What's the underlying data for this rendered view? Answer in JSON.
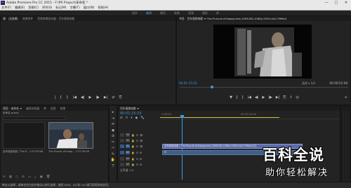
{
  "titlebar": {
    "app_badge": "Pr",
    "title": "Adobe Premiere Pro CC 2015 - F:\\PR Project\\未命名 *",
    "controls": [
      "—",
      "□",
      "✕"
    ]
  },
  "menubar": {
    "items": [
      "文件(F)",
      "编辑(E)",
      "剪辑(C)",
      "序列(S)",
      "标记(M)",
      "字幕(T)",
      "窗口(W)",
      "帮助(H)"
    ]
  },
  "workspaces": {
    "items": [
      "组件",
      "编辑",
      "颜色",
      "效果",
      "音频",
      "图形",
      "库"
    ],
    "active_index": 1
  },
  "source_panel": {
    "tabs": [
      "源：(无剪辑)",
      "效果控件",
      "音频剪辑混合器：百年孤独电影"
    ],
    "active_tab": 0,
    "transport": [
      "|",
      "{",
      "}",
      "|◀",
      "◀|",
      "▶",
      "|▶",
      "▶|",
      "⇄",
      "⎘"
    ]
  },
  "program_panel": {
    "title": "节目：百年孤独电影 ≡  The.Pursuit.of.Happyness.2006.BD-1080p.X264.AAC.99Mp4",
    "timecode_current": "00:01:15:23",
    "timecode_duration": "00:00:52:08",
    "fit_label": "适合",
    "quality": "1/2",
    "transport": [
      "▼",
      "{",
      "}",
      "|◀",
      "◀|",
      "▶",
      "|▶",
      "▶|",
      "⎘",
      "⇪",
      "◎"
    ],
    "add_button": "+"
  },
  "project_panel": {
    "tabs": [
      "项目：未命名 ≡",
      "媒体浏览器",
      "库",
      "信息",
      "效果"
    ],
    "active_tab": 0,
    "path": "未命名.prproj",
    "items_count": "1 项已选择，共 2 项",
    "items": [
      {
        "label": "百年孤独电影 | The.P...",
        "duration": "1:57:39:08"
      },
      {
        "label": "The.Pursuit.of.Happ...",
        "duration": "1:57:39:08"
      }
    ],
    "tools": [
      "≡",
      "▦",
      "○",
      "⊟",
      "▭",
      "⌕",
      "▣",
      "🗑"
    ]
  },
  "tool_icons": [
    "▸",
    "⇥",
    "⇹",
    "◆",
    "⊘",
    "✂",
    "⇿",
    "✎",
    "✋",
    "T"
  ],
  "timeline": {
    "title": "百年孤独电影 ≡",
    "timecode": "00:01:15:23",
    "ruler_labels": [
      "1:00:00",
      "00:01:20:00"
    ],
    "tools": [
      "⇄",
      "⊓",
      "▾",
      "◆",
      "🔧"
    ],
    "tracks": [
      {
        "type": "v",
        "name": "V3",
        "target": "V3",
        "on": false
      },
      {
        "type": "v",
        "name": "V2",
        "target": "V2",
        "on": false
      },
      {
        "type": "v",
        "name": "V1",
        "target": "V1",
        "on": true,
        "clip": "百年孤独电影 | The.Pursuit.of.Happyness.2006.BD-1080p.X264.AAC.99Mp4 [V]"
      },
      {
        "type": "a",
        "name": "A1",
        "target": "A1",
        "on": true,
        "clip": "M"
      },
      {
        "type": "a",
        "name": "A2",
        "target": "A2",
        "on": false
      },
      {
        "type": "a",
        "name": "A3",
        "target": "A3",
        "on": false
      },
      {
        "type": "a",
        "name": "主声道",
        "target": "",
        "on": false,
        "value": "0.0"
      }
    ],
    "track_controls": [
      "🔒",
      "⊡",
      "👁"
    ]
  },
  "statusbar": {
    "text": "单击以选择，或单击空白处并拖动以进行选择。使用 Shift、Alt 和 Ctrl 键可获得其他选项。"
  },
  "watermark": {
    "main": "百科全说",
    "sub": "助你轻松解决"
  }
}
